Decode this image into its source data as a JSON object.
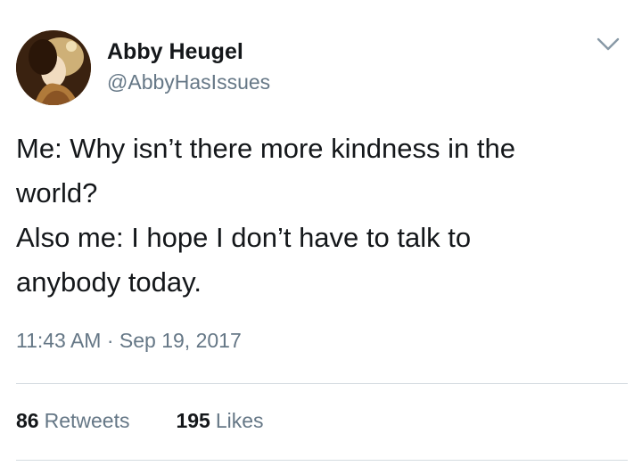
{
  "author": {
    "name": "Abby Heugel",
    "handle": "@AbbyHasIssues"
  },
  "tweet": {
    "lines": [
      "Me: Why isn’t there more kindness in the",
      "world?",
      "Also me: I hope I don’t have to talk to",
      "anybody today."
    ],
    "timestamp": "11:43 AM · Sep 19, 2017"
  },
  "stats": {
    "retweets_count": "86",
    "retweets_label": "Retweets",
    "likes_count": "195",
    "likes_label": "Likes"
  },
  "icons": {
    "menu": "chevron-down-icon"
  },
  "colors": {
    "text": "#14171a",
    "secondary": "#657786",
    "divider": "#d4dbe0"
  }
}
